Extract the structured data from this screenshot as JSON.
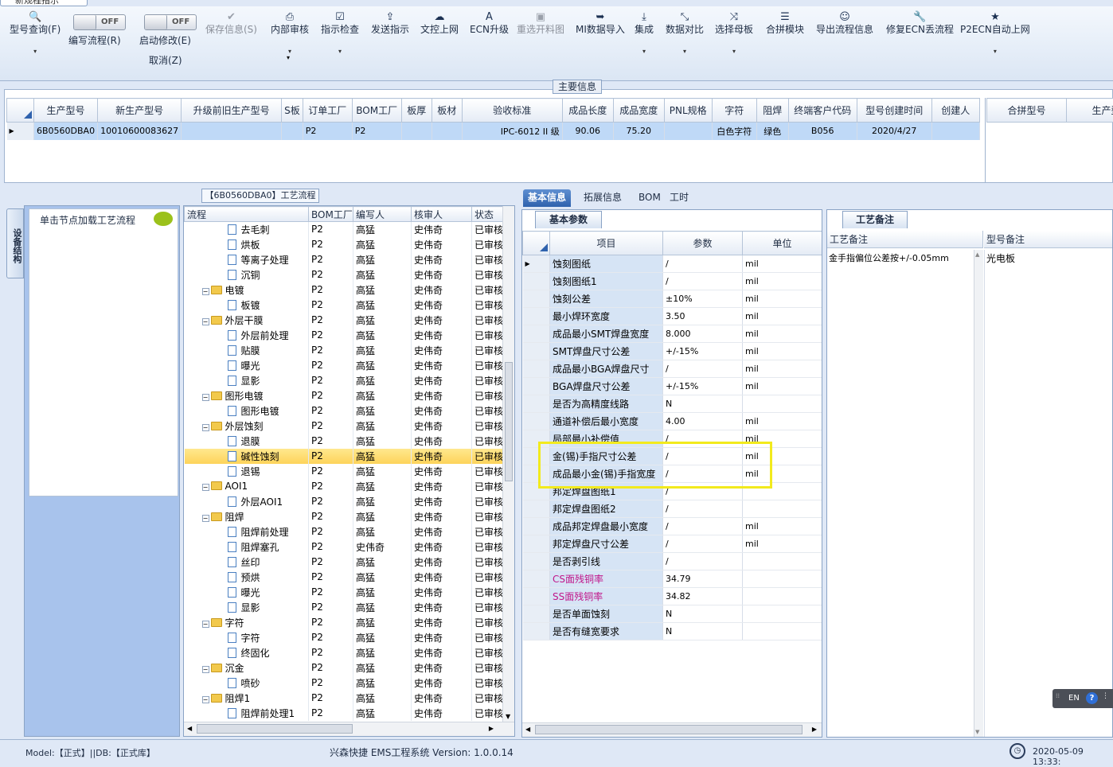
{
  "window": {
    "title": "新规程指示"
  },
  "toolbar": {
    "items": [
      {
        "label": "型号查询(F)",
        "icon": "search-icon",
        "has_dropdown": true,
        "enabled": true
      },
      {
        "label": "保存信息(S)",
        "icon": "check-icon",
        "has_dropdown": false,
        "enabled": false
      },
      {
        "label": "内部审核",
        "icon": "printer-icon",
        "has_dropdown": true,
        "enabled": true
      },
      {
        "label": "指示检查",
        "icon": "checkbox-icon",
        "has_dropdown": true,
        "enabled": true
      },
      {
        "label": "发送指示",
        "icon": "upload-icon",
        "has_dropdown": false,
        "enabled": true
      },
      {
        "label": "文控上网",
        "icon": "cloud-upload-icon",
        "has_dropdown": false,
        "enabled": true
      },
      {
        "label": "ECN升级",
        "icon": "font-icon",
        "has_dropdown": false,
        "enabled": true
      },
      {
        "label": "重选开料图",
        "icon": "image-icon",
        "has_dropdown": false,
        "enabled": false
      },
      {
        "label": "MI数据导入",
        "icon": "sign-in-icon",
        "has_dropdown": false,
        "enabled": true
      },
      {
        "label": "集成",
        "icon": "download-icon",
        "has_dropdown": true,
        "enabled": true
      },
      {
        "label": "数据对比",
        "icon": "compress-icon",
        "has_dropdown": true,
        "enabled": true
      },
      {
        "label": "选择母板",
        "icon": "shuffle-icon",
        "has_dropdown": true,
        "enabled": true
      },
      {
        "label": "合拼模块",
        "icon": "list-icon",
        "has_dropdown": false,
        "enabled": true
      },
      {
        "label": "导出流程信息",
        "icon": "smile-icon",
        "has_dropdown": false,
        "enabled": true
      },
      {
        "label": "修复ECN丢流程",
        "icon": "wrench-icon",
        "has_dropdown": false,
        "enabled": true
      },
      {
        "label": "P2ECN自动上网",
        "icon": "star-icon",
        "has_dropdown": true,
        "enabled": true
      }
    ],
    "toggles": [
      {
        "state": "OFF",
        "label": "编写流程(R)"
      },
      {
        "state": "OFF",
        "label": "启动修改(E)",
        "sublabel": "取消(Z)"
      }
    ]
  },
  "main_info": {
    "caption": "主要信息",
    "columns": [
      "生产型号",
      "新生产型号",
      "升级前旧生产型号",
      "S板",
      "订单工厂",
      "BOM工厂",
      "板厚",
      "板材",
      "验收标准",
      "成品长度",
      "成品宽度",
      "PNL规格",
      "字符",
      "阻焊",
      "终端客户代码",
      "型号创建时间",
      "创建人"
    ],
    "row": [
      "6B0560DBA0",
      "10010600083627",
      "",
      "",
      "P2",
      "P2",
      "",
      "",
      "IPC-6012 II 级",
      "90.06",
      "75.20",
      "",
      "白色字符",
      "绿色",
      "B056",
      "2020/4/27",
      ""
    ],
    "side_columns": [
      "合拼型号",
      "生产型"
    ]
  },
  "left_panel": {
    "vertical_tab": "设备结构",
    "hint": "单击节点加载工艺流程"
  },
  "process": {
    "caption": "【6B0560DBA0】工艺流程",
    "columns": [
      "流程",
      "BOM工厂",
      "编写人",
      "核审人",
      "状态"
    ],
    "rows": [
      {
        "name": "去毛刺",
        "level": 2,
        "folder": false,
        "bom": "P2",
        "writer": "高猛",
        "reviewer": "史伟奇",
        "status": "已审核"
      },
      {
        "name": "烘板",
        "level": 2,
        "folder": false,
        "bom": "P2",
        "writer": "高猛",
        "reviewer": "史伟奇",
        "status": "已审核"
      },
      {
        "name": "等离子处理",
        "level": 2,
        "folder": false,
        "bom": "P2",
        "writer": "高猛",
        "reviewer": "史伟奇",
        "status": "已审核"
      },
      {
        "name": "沉铜",
        "level": 2,
        "folder": false,
        "bom": "P2",
        "writer": "高猛",
        "reviewer": "史伟奇",
        "status": "已审核"
      },
      {
        "name": "电镀",
        "level": 1,
        "folder": true,
        "bom": "P2",
        "writer": "高猛",
        "reviewer": "史伟奇",
        "status": "已审核"
      },
      {
        "name": "板镀",
        "level": 2,
        "folder": false,
        "bom": "P2",
        "writer": "高猛",
        "reviewer": "史伟奇",
        "status": "已审核"
      },
      {
        "name": "外层干膜",
        "level": 1,
        "folder": true,
        "bom": "P2",
        "writer": "高猛",
        "reviewer": "史伟奇",
        "status": "已审核"
      },
      {
        "name": "外层前处理",
        "level": 2,
        "folder": false,
        "bom": "P2",
        "writer": "高猛",
        "reviewer": "史伟奇",
        "status": "已审核"
      },
      {
        "name": "贴膜",
        "level": 2,
        "folder": false,
        "bom": "P2",
        "writer": "高猛",
        "reviewer": "史伟奇",
        "status": "已审核"
      },
      {
        "name": "曝光",
        "level": 2,
        "folder": false,
        "bom": "P2",
        "writer": "高猛",
        "reviewer": "史伟奇",
        "status": "已审核"
      },
      {
        "name": "显影",
        "level": 2,
        "folder": false,
        "bom": "P2",
        "writer": "高猛",
        "reviewer": "史伟奇",
        "status": "已审核"
      },
      {
        "name": "图形电镀",
        "level": 1,
        "folder": true,
        "bom": "P2",
        "writer": "高猛",
        "reviewer": "史伟奇",
        "status": "已审核"
      },
      {
        "name": "图形电镀",
        "level": 2,
        "folder": false,
        "bom": "P2",
        "writer": "高猛",
        "reviewer": "史伟奇",
        "status": "已审核"
      },
      {
        "name": "外层蚀刻",
        "level": 1,
        "folder": true,
        "bom": "P2",
        "writer": "高猛",
        "reviewer": "史伟奇",
        "status": "已审核"
      },
      {
        "name": "退膜",
        "level": 2,
        "folder": false,
        "bom": "P2",
        "writer": "高猛",
        "reviewer": "史伟奇",
        "status": "已审核"
      },
      {
        "name": "碱性蚀刻",
        "level": 2,
        "folder": false,
        "bom": "P2",
        "writer": "高猛",
        "reviewer": "史伟奇",
        "status": "已审核",
        "selected": true
      },
      {
        "name": "退锡",
        "level": 2,
        "folder": false,
        "bom": "P2",
        "writer": "高猛",
        "reviewer": "史伟奇",
        "status": "已审核"
      },
      {
        "name": "AOI1",
        "level": 1,
        "folder": true,
        "bom": "P2",
        "writer": "高猛",
        "reviewer": "史伟奇",
        "status": "已审核"
      },
      {
        "name": "外层AOI1",
        "level": 2,
        "folder": false,
        "bom": "P2",
        "writer": "高猛",
        "reviewer": "史伟奇",
        "status": "已审核"
      },
      {
        "name": "阻焊",
        "level": 1,
        "folder": true,
        "bom": "P2",
        "writer": "高猛",
        "reviewer": "史伟奇",
        "status": "已审核"
      },
      {
        "name": "阻焊前处理",
        "level": 2,
        "folder": false,
        "bom": "P2",
        "writer": "高猛",
        "reviewer": "史伟奇",
        "status": "已审核"
      },
      {
        "name": "阻焊塞孔",
        "level": 2,
        "folder": false,
        "bom": "P2",
        "writer": "史伟奇",
        "reviewer": "史伟奇",
        "status": "已审核"
      },
      {
        "name": "丝印",
        "level": 2,
        "folder": false,
        "bom": "P2",
        "writer": "高猛",
        "reviewer": "史伟奇",
        "status": "已审核"
      },
      {
        "name": "预烘",
        "level": 2,
        "folder": false,
        "bom": "P2",
        "writer": "高猛",
        "reviewer": "史伟奇",
        "status": "已审核"
      },
      {
        "name": "曝光",
        "level": 2,
        "folder": false,
        "bom": "P2",
        "writer": "高猛",
        "reviewer": "史伟奇",
        "status": "已审核"
      },
      {
        "name": "显影",
        "level": 2,
        "folder": false,
        "bom": "P2",
        "writer": "高猛",
        "reviewer": "史伟奇",
        "status": "已审核"
      },
      {
        "name": "字符",
        "level": 1,
        "folder": true,
        "bom": "P2",
        "writer": "高猛",
        "reviewer": "史伟奇",
        "status": "已审核"
      },
      {
        "name": "字符",
        "level": 2,
        "folder": false,
        "bom": "P2",
        "writer": "高猛",
        "reviewer": "史伟奇",
        "status": "已审核"
      },
      {
        "name": "终固化",
        "level": 2,
        "folder": false,
        "bom": "P2",
        "writer": "高猛",
        "reviewer": "史伟奇",
        "status": "已审核"
      },
      {
        "name": "沉金",
        "level": 1,
        "folder": true,
        "bom": "P2",
        "writer": "高猛",
        "reviewer": "史伟奇",
        "status": "已审核"
      },
      {
        "name": "喷砂",
        "level": 2,
        "folder": false,
        "bom": "P2",
        "writer": "高猛",
        "reviewer": "史伟奇",
        "status": "已审核"
      },
      {
        "name": "阻焊1",
        "level": 1,
        "folder": true,
        "bom": "P2",
        "writer": "高猛",
        "reviewer": "史伟奇",
        "status": "已审核"
      },
      {
        "name": "阻焊前处理1",
        "level": 2,
        "folder": false,
        "bom": "P2",
        "writer": "高猛",
        "reviewer": "史伟奇",
        "status": "已审核"
      }
    ]
  },
  "right_tabs": [
    "基本信息",
    "拓展信息",
    "BOM",
    "工时"
  ],
  "basic_params": {
    "caption": "基本参数",
    "columns": [
      "项目",
      "参数",
      "单位"
    ],
    "rows": [
      {
        "item": "蚀刻图纸",
        "value": "/",
        "unit": "mil",
        "current": true
      },
      {
        "item": "蚀刻图纸1",
        "value": "/",
        "unit": "mil"
      },
      {
        "item": "蚀刻公差",
        "value": "±10%",
        "unit": "mil"
      },
      {
        "item": "最小焊环宽度",
        "value": "3.50",
        "unit": "mil"
      },
      {
        "item": "成品最小SMT焊盘宽度",
        "value": "8.000",
        "unit": "mil"
      },
      {
        "item": "SMT焊盘尺寸公差",
        "value": "+/-15%",
        "unit": "mil"
      },
      {
        "item": "成品最小BGA焊盘尺寸",
        "value": "/",
        "unit": "mil"
      },
      {
        "item": "BGA焊盘尺寸公差",
        "value": "+/-15%",
        "unit": "mil"
      },
      {
        "item": "是否为高精度线路",
        "value": "N",
        "unit": ""
      },
      {
        "item": "通道补偿后最小宽度",
        "value": "4.00",
        "unit": "mil"
      },
      {
        "item": "局部最小补偿值",
        "value": "/",
        "unit": "mil"
      },
      {
        "item": "金(锡)手指尺寸公差",
        "value": "/",
        "unit": "mil"
      },
      {
        "item": "成品最小金(锡)手指宽度",
        "value": "/",
        "unit": "mil"
      },
      {
        "item": "邦定焊盘图纸1",
        "value": "/",
        "unit": ""
      },
      {
        "item": "邦定焊盘图纸2",
        "value": "/",
        "unit": ""
      },
      {
        "item": "成品邦定焊盘最小宽度",
        "value": "/",
        "unit": "mil"
      },
      {
        "item": "邦定焊盘尺寸公差",
        "value": "/",
        "unit": "mil"
      },
      {
        "item": "是否剥引线",
        "value": "/",
        "unit": ""
      },
      {
        "item": "CS面残铜率",
        "value": "34.79",
        "unit": "",
        "magenta": true
      },
      {
        "item": "SS面残铜率",
        "value": "34.82",
        "unit": "",
        "magenta": true
      },
      {
        "item": "是否单面蚀刻",
        "value": "N",
        "unit": ""
      },
      {
        "item": "是否有缝宽要求",
        "value": "N",
        "unit": ""
      }
    ]
  },
  "remarks": {
    "caption": "工艺备注",
    "columns": [
      "工艺备注",
      "型号备注"
    ],
    "process_remark": "金手指偏位公差按+/-0.05mm",
    "model_remark": "光电板"
  },
  "status": {
    "model": "Model:【正式】||DB:【正式库】",
    "system": "兴森快捷 EMS工程系统 Version: 1.0.0.14",
    "datetime": "2020-05-09 13:33:"
  },
  "ime": {
    "lang": "EN",
    "help": "?"
  },
  "colors": {
    "accent": "#2f62ad",
    "highlight_box": "#f2ea1d",
    "row_select": "#bfd9f7",
    "tree_select": "#fdd35a"
  }
}
